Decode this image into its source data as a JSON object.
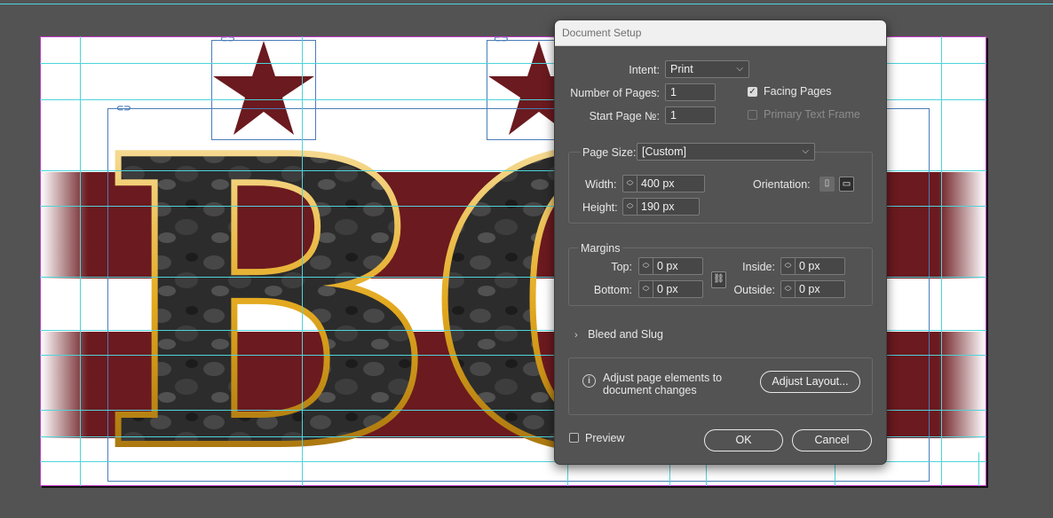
{
  "canvas": {
    "headline_letters": "BO",
    "colors": {
      "stripe_red": "#6b1a1f",
      "star_red": "#6b1a1f",
      "gold": "#d9a020",
      "guide": "#4fd3db",
      "pasteboard": "#535353"
    }
  },
  "dialog": {
    "title": "Document Setup",
    "intent_label": "Intent:",
    "intent_value": "Print",
    "num_pages_label": "Number of Pages:",
    "num_pages_value": "1",
    "facing_pages_label": "Facing Pages",
    "facing_pages_checked": true,
    "start_page_label": "Start Page №:",
    "start_page_value": "1",
    "primary_text_frame_label": "Primary Text Frame",
    "primary_text_frame_checked": false,
    "page_size_label": "Page Size:",
    "page_size_value": "[Custom]",
    "width_label": "Width:",
    "width_value": "400 px",
    "height_label": "Height:",
    "height_value": "190 px",
    "orientation_label": "Orientation:",
    "margins": {
      "title": "Margins",
      "top_label": "Top:",
      "top_value": "0 px",
      "bottom_label": "Bottom:",
      "bottom_value": "0 px",
      "inside_label": "Inside:",
      "inside_value": "0 px",
      "outside_label": "Outside:",
      "outside_value": "0 px"
    },
    "bleed_slug_label": "Bleed and Slug",
    "adjust_info_text_1": "Adjust page elements to",
    "adjust_info_text_2": "document changes",
    "adjust_layout_button": "Adjust Layout...",
    "preview_label": "Preview",
    "preview_checked": false,
    "ok_button": "OK",
    "cancel_button": "Cancel"
  }
}
